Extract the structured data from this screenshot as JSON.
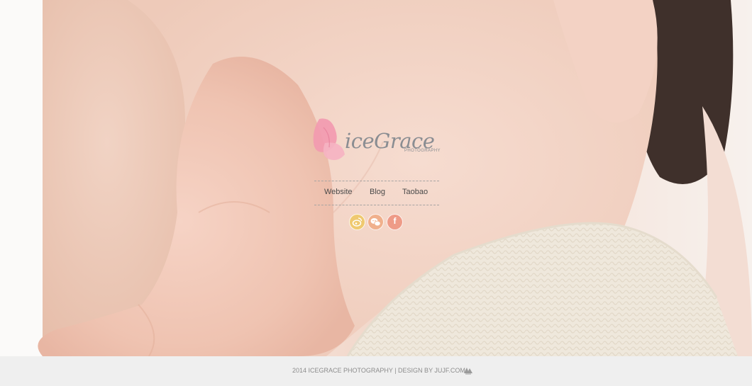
{
  "brand": {
    "name": "iceGrace",
    "subtitle": "PHOTOGRAPHY",
    "logo_icon": "butterfly-icon",
    "logo_color": "#f08aa0"
  },
  "nav": {
    "items": [
      {
        "label": "Website"
      },
      {
        "label": "Blog"
      },
      {
        "label": "Taobao"
      }
    ]
  },
  "social": {
    "items": [
      {
        "icon": "weibo-icon",
        "color": "#efc970"
      },
      {
        "icon": "wechat-icon",
        "color": "#f0b08c"
      },
      {
        "icon": "facebook-icon",
        "label": "f",
        "color": "#ee9b87"
      }
    ]
  },
  "footer": {
    "text": "2014 ICEGRACE PHOTOGRAPHY | DESIGN BY JUJF.COM",
    "logo_icon": "designer-logo-icon"
  },
  "colors": {
    "skin": "#f4d5c6",
    "blanket": "#efe7da",
    "hair": "#4a3a35",
    "footer_bg": "#efefef"
  }
}
